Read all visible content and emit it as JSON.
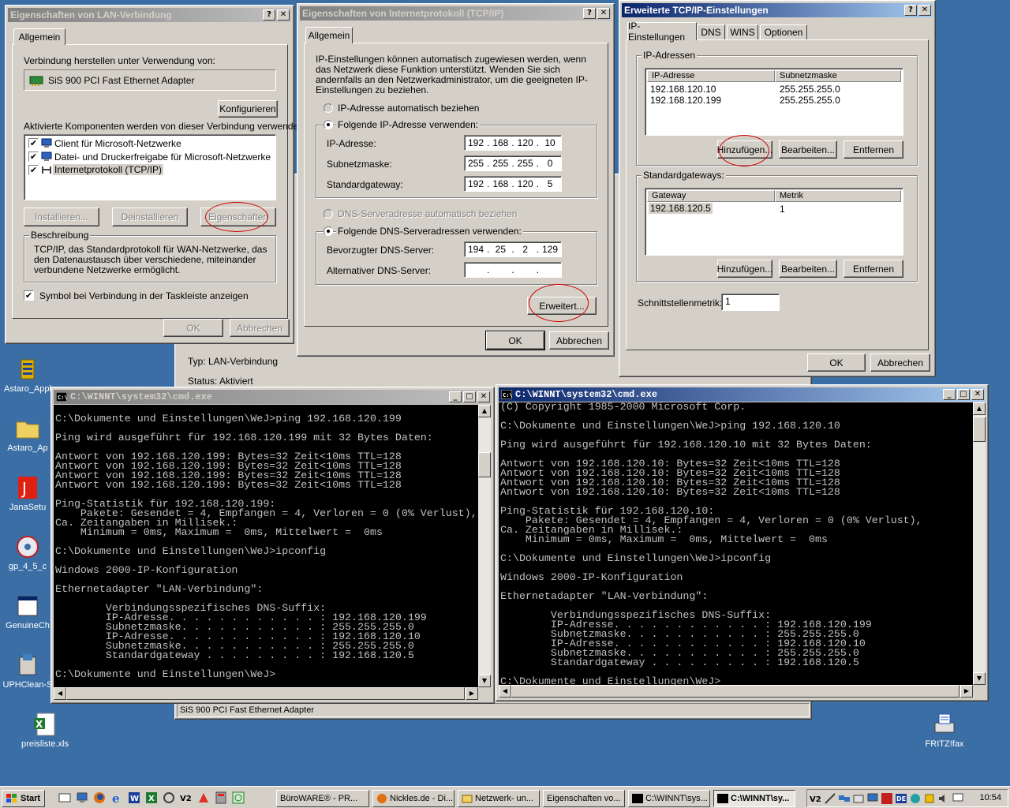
{
  "background_window": {
    "typ": "Typ: LAN-Verbindung",
    "status": "Status: Aktiviert",
    "statusbar": "SiS 900 PCI Fast Ethernet Adapter"
  },
  "lan_dialog": {
    "title": "Eigenschaften von LAN-Verbindung",
    "tab": "Allgemein",
    "connect_using": "Verbindung herstellen unter Verwendung von:",
    "adapter": "SiS 900 PCI Fast Ethernet Adapter",
    "configure": "Konfigurieren",
    "components_label": "Aktivierte Komponenten werden von dieser Verbindung verwendet:",
    "components": [
      "Client für Microsoft-Netzwerke",
      "Datei- und Druckerfreigabe für Microsoft-Netzwerke",
      "Internetprotokoll (TCP/IP)"
    ],
    "install": "Installieren...",
    "uninstall": "Deinstallieren",
    "properties": "Eigenschaften",
    "description_title": "Beschreibung",
    "description": "TCP/IP, das Standardprotokoll für WAN-Netzwerke, das den Datenaustausch über verschiedene, miteinander verbundene Netzwerke ermöglicht.",
    "show_icon": "Symbol bei Verbindung in der Taskleiste anzeigen",
    "ok": "OK",
    "cancel": "Abbrechen"
  },
  "tcpip_dialog": {
    "title": "Eigenschaften von Internetprotokoll (TCP/IP)",
    "tab": "Allgemein",
    "intro": "IP-Einstellungen können automatisch zugewiesen werden, wenn das Netzwerk diese Funktion unterstützt. Wenden Sie sich andernfalls an den Netzwerkadministrator, um die geeigneten IP-Einstellungen zu beziehen.",
    "auto_ip": "IP-Adresse automatisch beziehen",
    "use_ip": "Folgende IP-Adresse verwenden:",
    "ip_label": "IP-Adresse:",
    "ip": [
      "192",
      "168",
      "120",
      "10"
    ],
    "mask_label": "Subnetzmaske:",
    "mask": [
      "255",
      "255",
      "255",
      "0"
    ],
    "gw_label": "Standardgateway:",
    "gw": [
      "192",
      "168",
      "120",
      "5"
    ],
    "auto_dns": "DNS-Serveradresse automatisch beziehen",
    "use_dns": "Folgende DNS-Serveradressen verwenden:",
    "dns1_label": "Bevorzugter DNS-Server:",
    "dns1": [
      "194",
      "25",
      "2",
      "129"
    ],
    "dns2_label": "Alternativer DNS-Server:",
    "dns2": [
      "",
      "",
      "",
      ""
    ],
    "advanced": "Erweitert...",
    "ok": "OK",
    "cancel": "Abbrechen"
  },
  "advanced_dialog": {
    "title": "Erweiterte TCP/IP-Einstellungen",
    "tabs": [
      "IP-Einstellungen",
      "DNS",
      "WINS",
      "Optionen"
    ],
    "ip_group": "IP-Adressen",
    "ip_headers": [
      "IP-Adresse",
      "Subnetzmaske"
    ],
    "ip_rows": [
      [
        "192.168.120.10",
        "255.255.255.0"
      ],
      [
        "192.168.120.199",
        "255.255.255.0"
      ]
    ],
    "add": "Hinzufügen...",
    "edit": "Bearbeiten...",
    "remove": "Entfernen",
    "gw_group": "Standardgateways:",
    "gw_headers": [
      "Gateway",
      "Metrik"
    ],
    "gw_rows": [
      [
        "192.168.120.5",
        "1"
      ]
    ],
    "metric_label": "Schnittstellenmetrik:",
    "metric": "1",
    "ok": "OK",
    "cancel": "Abbrechen"
  },
  "cmd1": {
    "title": "C:\\WINNT\\system32\\cmd.exe",
    "lines": [
      "",
      "C:\\Dokumente und Einstellungen\\WeJ>ping 192.168.120.199",
      "",
      "Ping wird ausgeführt für 192.168.120.199 mit 32 Bytes Daten:",
      "",
      "Antwort von 192.168.120.199: Bytes=32 Zeit<10ms TTL=128",
      "Antwort von 192.168.120.199: Bytes=32 Zeit<10ms TTL=128",
      "Antwort von 192.168.120.199: Bytes=32 Zeit<10ms TTL=128",
      "Antwort von 192.168.120.199: Bytes=32 Zeit<10ms TTL=128",
      "",
      "Ping-Statistik für 192.168.120.199:",
      "    Pakete: Gesendet = 4, Empfangen = 4, Verloren = 0 (0% Verlust),",
      "Ca. Zeitangaben in Millisek.:",
      "    Minimum = 0ms, Maximum =  0ms, Mittelwert =  0ms",
      "",
      "C:\\Dokumente und Einstellungen\\WeJ>ipconfig",
      "",
      "Windows 2000-IP-Konfiguration",
      "",
      "Ethernetadapter \"LAN-Verbindung\":",
      "",
      "        Verbindungsspezifisches DNS-Suffix:",
      "        IP-Adresse. . . . . . . . . . . . : 192.168.120.199",
      "        Subnetzmaske. . . . . . . . . . . : 255.255.255.0",
      "        IP-Adresse. . . . . . . . . . . . : 192.168.120.10",
      "        Subnetzmaske. . . . . . . . . . . : 255.255.255.0",
      "        Standardgateway . . . . . . . . . : 192.168.120.5",
      "",
      "C:\\Dokumente und Einstellungen\\WeJ>"
    ]
  },
  "cmd2": {
    "title": "C:\\WINNT\\system32\\cmd.exe",
    "lines": [
      "(C) Copyright 1985-2000 Microsoft Corp.",
      "",
      "C:\\Dokumente und Einstellungen\\WeJ>ping 192.168.120.10",
      "",
      "Ping wird ausgeführt für 192.168.120.10 mit 32 Bytes Daten:",
      "",
      "Antwort von 192.168.120.10: Bytes=32 Zeit<10ms TTL=128",
      "Antwort von 192.168.120.10: Bytes=32 Zeit<10ms TTL=128",
      "Antwort von 192.168.120.10: Bytes=32 Zeit<10ms TTL=128",
      "Antwort von 192.168.120.10: Bytes=32 Zeit<10ms TTL=128",
      "",
      "Ping-Statistik für 192.168.120.10:",
      "    Pakete: Gesendet = 4, Empfangen = 4, Verloren = 0 (0% Verlust),",
      "Ca. Zeitangaben in Millisek.:",
      "    Minimum = 0ms, Maximum =  0ms, Mittelwert =  0ms",
      "",
      "C:\\Dokumente und Einstellungen\\WeJ>ipconfig",
      "",
      "Windows 2000-IP-Konfiguration",
      "",
      "Ethernetadapter \"LAN-Verbindung\":",
      "",
      "        Verbindungsspezifisches DNS-Suffix:",
      "        IP-Adresse. . . . . . . . . . . . : 192.168.120.199",
      "        Subnetzmaske. . . . . . . . . . . : 255.255.255.0",
      "        IP-Adresse. . . . . . . . . . . . : 192.168.120.10",
      "        Subnetzmaske. . . . . . . . . . . : 255.255.255.0",
      "        Standardgateway . . . . . . . . . : 192.168.120.5",
      "",
      "C:\\Dokumente und Einstellungen\\WeJ>"
    ]
  },
  "desktop_icons": [
    {
      "label": "Astaro_Appl",
      "icon": "database-icon"
    },
    {
      "label": "Astaro_Ap",
      "icon": "folder-icon"
    },
    {
      "label": "JanaSetu",
      "icon": "java-icon"
    },
    {
      "label": "gp_4_5_c",
      "icon": "cd-icon"
    },
    {
      "label": "GenuineCh",
      "icon": "window-icon"
    },
    {
      "label": "UPHClean-S",
      "icon": "installer-icon"
    },
    {
      "label": "preisliste.xls",
      "icon": "excel-icon"
    },
    {
      "label": "FRITZ!fax",
      "icon": "fax-icon"
    }
  ],
  "taskbar": {
    "start": "Start",
    "buttons": [
      "BüroWARE® - PR...",
      "Nickles.de - Di...",
      "Netzwerk- un...",
      "Eigenschaften vo...",
      "C:\\WINNT\\sys...",
      "C:\\WINNT\\sy..."
    ],
    "clock": "10:54"
  }
}
